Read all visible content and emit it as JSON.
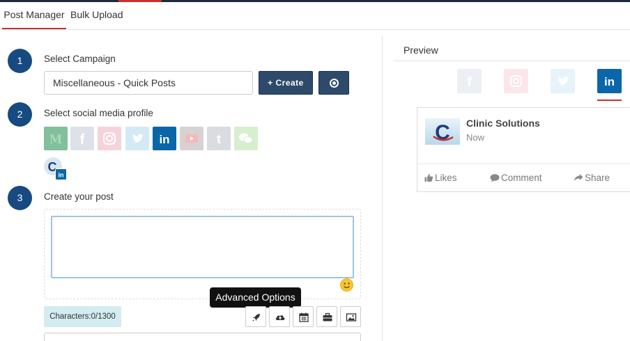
{
  "tabs": {
    "post_manager": "Post Manager",
    "bulk_upload": "Bulk Upload"
  },
  "steps": {
    "one": {
      "number": "1",
      "label": "Select Campaign"
    },
    "two": {
      "number": "2",
      "label": "Select social media profile"
    },
    "three": {
      "number": "3",
      "label": "Create your post"
    }
  },
  "campaign": {
    "value": "Miscellaneous - Quick Posts",
    "create_label": "+ Create"
  },
  "social_profiles": [
    {
      "name": "medium-icon",
      "color": "#6bb68a"
    },
    {
      "name": "facebook-icon",
      "color": "#dde2ea"
    },
    {
      "name": "instagram-icon",
      "color": "#f6d3db"
    },
    {
      "name": "twitter-icon",
      "color": "#d3e9f6"
    },
    {
      "name": "linkedin-icon",
      "color": "#0a66a8"
    },
    {
      "name": "youtube-icon",
      "color": "#d8d2d2"
    },
    {
      "name": "tumblr-icon",
      "color": "#dadde0"
    },
    {
      "name": "wechat-icon",
      "color": "#d6efce"
    }
  ],
  "post": {
    "text": "",
    "characters": "Characters:0/1300",
    "tooltip": "Advanced Options"
  },
  "toolbar": [
    "rocket-icon",
    "cloud-upload-icon",
    "calendar-icon",
    "briefcase-icon",
    "image-icon"
  ],
  "preview": {
    "title": "Preview",
    "card": {
      "name": "Clinic Solutions",
      "time": "Now",
      "likes": "Likes",
      "comment": "Comment",
      "share": "Share"
    }
  },
  "colors": {
    "accent_red": "#c9302c",
    "step_blue": "#174a80",
    "button_navy": "#2e4a6b",
    "linkedin_blue": "#0a66a8"
  }
}
